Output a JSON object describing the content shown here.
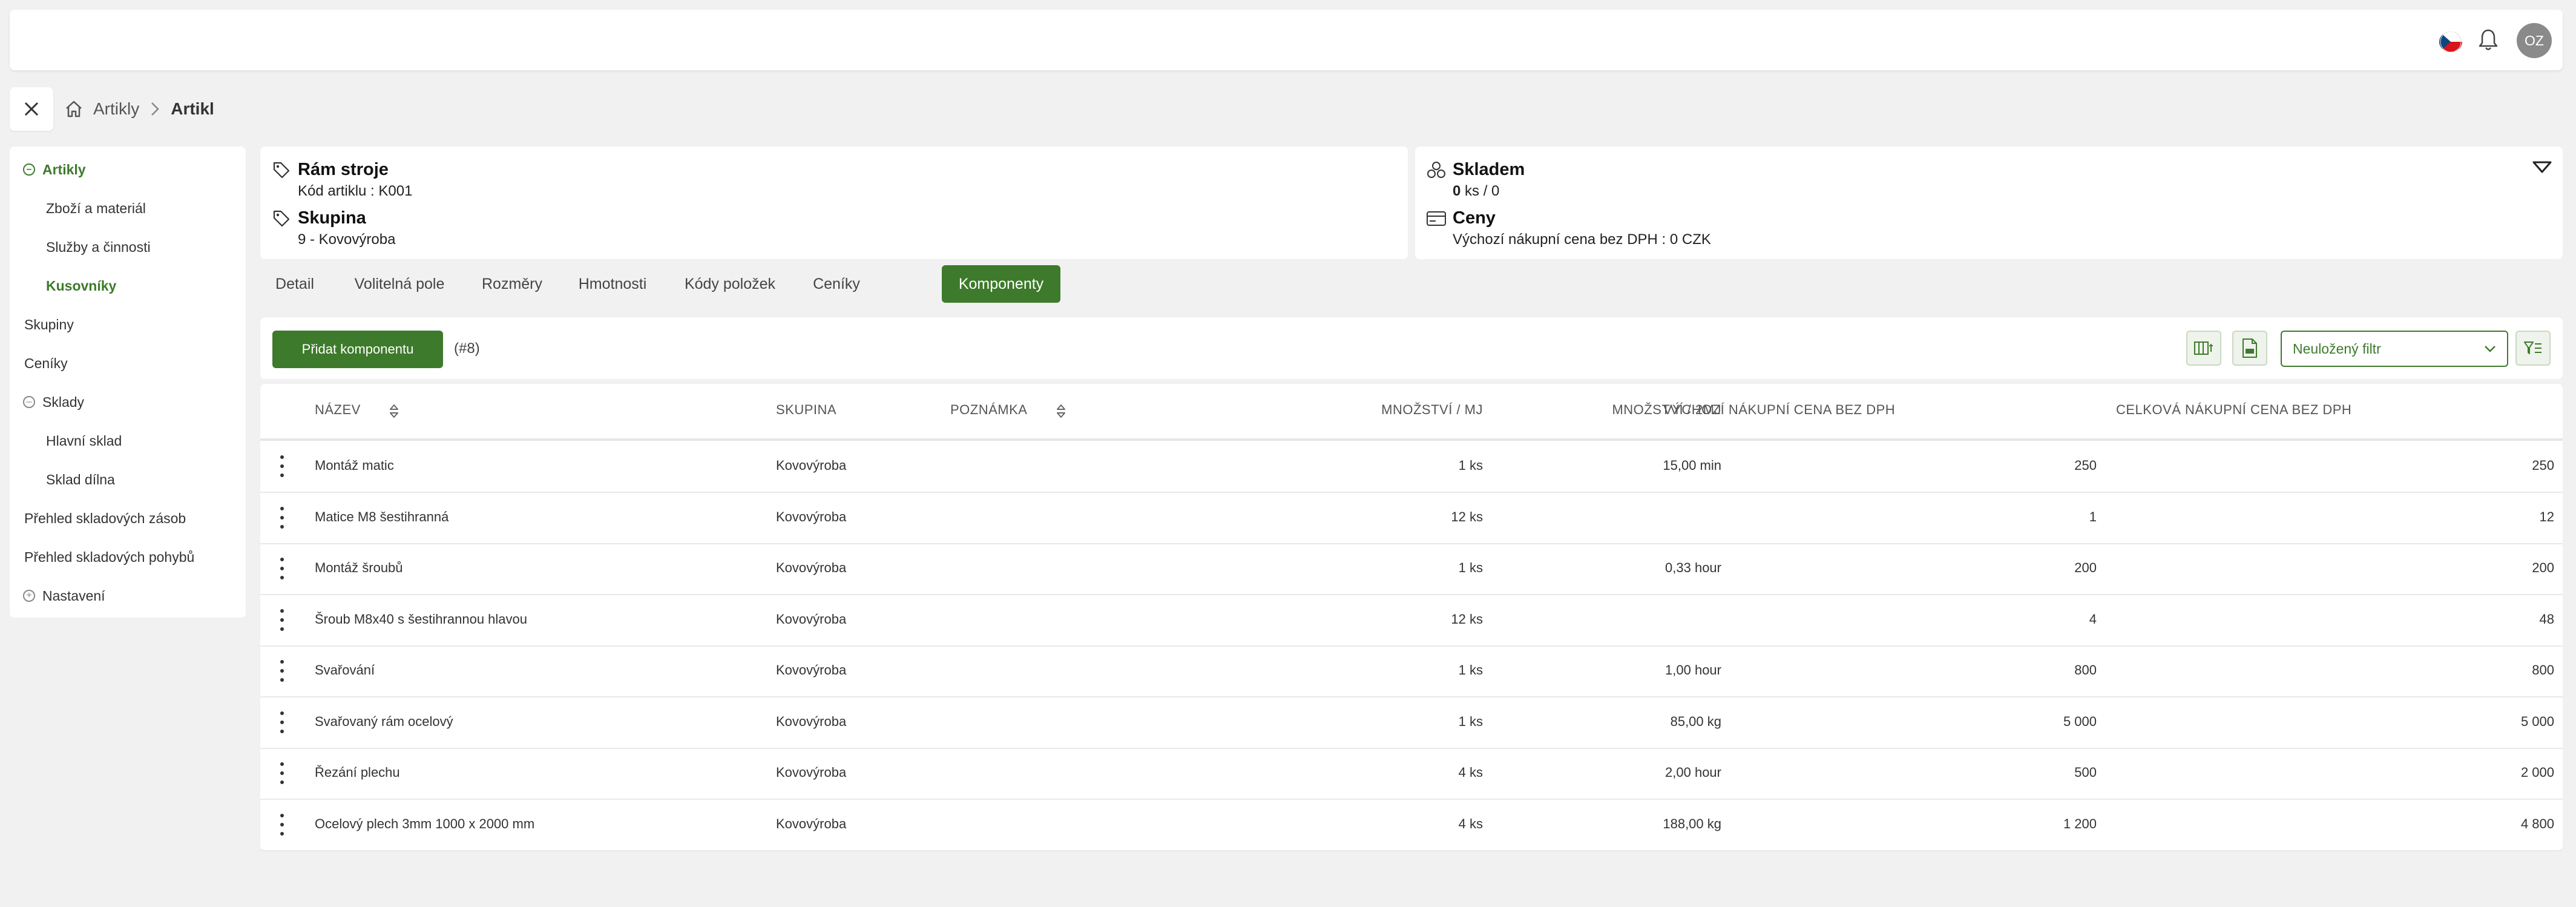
{
  "header": {
    "avatar_initials": "OZ"
  },
  "breadcrumb": {
    "items": [
      "Artikly",
      "Artikl"
    ]
  },
  "sidebar": {
    "items": [
      {
        "label": "Artikly",
        "state": "expanded-active"
      },
      {
        "label": "Zboží a materiál"
      },
      {
        "label": "Služby a činnosti"
      },
      {
        "label": "Kusovníky",
        "state": "active"
      },
      {
        "label": "Skupiny"
      },
      {
        "label": "Ceníky"
      },
      {
        "label": "Sklady",
        "state": "expanded"
      },
      {
        "label": "Hlavní sklad"
      },
      {
        "label": "Sklad dílna"
      },
      {
        "label": "Přehled skladových zásob"
      },
      {
        "label": "Přehled skladových pohybů"
      },
      {
        "label": "Nastavení",
        "state": "collapsed"
      }
    ]
  },
  "article": {
    "name": "Rám stroje",
    "code_line": "Kód artiklu : K001",
    "group_heading": "Skupina",
    "group_value": "9 - Kovovýroba"
  },
  "stock": {
    "heading": "Skladem",
    "qty_bold": "0",
    "qty_rest": " ks / 0",
    "prices_heading": "Ceny",
    "price_line": "Výchozí nákupní cena bez DPH : 0 CZK"
  },
  "tabs": [
    "Detail",
    "Volitelná pole",
    "Rozměry",
    "Hmotnosti",
    "Kódy položek",
    "Ceníky",
    "Komponenty"
  ],
  "active_tab": "Komponenty",
  "toolbar": {
    "add_label": "Přidat komponentu",
    "count": "(#8)",
    "filter_label": "Neuložený filtr"
  },
  "table": {
    "headers": [
      "NÁZEV",
      "SKUPINA",
      "POZNÁMKA",
      "MNOŽSTVÍ / MJ",
      "MNOŽSTVÍ / 2MJ",
      "VÝCHOZÍ NÁKUPNÍ CENA BEZ DPH",
      "CELKOVÁ NÁKUPNÍ CENA BEZ DPH"
    ],
    "rows": [
      {
        "name": "Montáž matic",
        "group": "Kovovýroba",
        "note": "",
        "qty": "1 ks",
        "qty2": "15,00 min",
        "price": "250",
        "total": "250"
      },
      {
        "name": "Matice M8 šestihranná",
        "group": "Kovovýroba",
        "note": "",
        "qty": "12 ks",
        "qty2": "",
        "price": "1",
        "total": "12"
      },
      {
        "name": "Montáž šroubů",
        "group": "Kovovýroba",
        "note": "",
        "qty": "1 ks",
        "qty2": "0,33 hour",
        "price": "200",
        "total": "200"
      },
      {
        "name": "Šroub M8x40 s šestihrannou hlavou",
        "group": "Kovovýroba",
        "note": "",
        "qty": "12 ks",
        "qty2": "",
        "price": "4",
        "total": "48"
      },
      {
        "name": "Svařování",
        "group": "Kovovýroba",
        "note": "",
        "qty": "1 ks",
        "qty2": "1,00 hour",
        "price": "800",
        "total": "800"
      },
      {
        "name": "Svařovaný rám ocelový",
        "group": "Kovovýroba",
        "note": "",
        "qty": "1 ks",
        "qty2": "85,00 kg",
        "price": "5 000",
        "total": "5 000"
      },
      {
        "name": "Řezání plechu",
        "group": "Kovovýroba",
        "note": "",
        "qty": "4 ks",
        "qty2": "2,00 hour",
        "price": "500",
        "total": "2 000"
      },
      {
        "name": "Ocelový plech 3mm 1000 x 2000 mm",
        "group": "Kovovýroba",
        "note": "",
        "qty": "4 ks",
        "qty2": "188,00 kg",
        "price": "1 200",
        "total": "4 800"
      }
    ]
  },
  "colors": {
    "accent": "#3d7a2b",
    "background": "#f1f1f1"
  }
}
